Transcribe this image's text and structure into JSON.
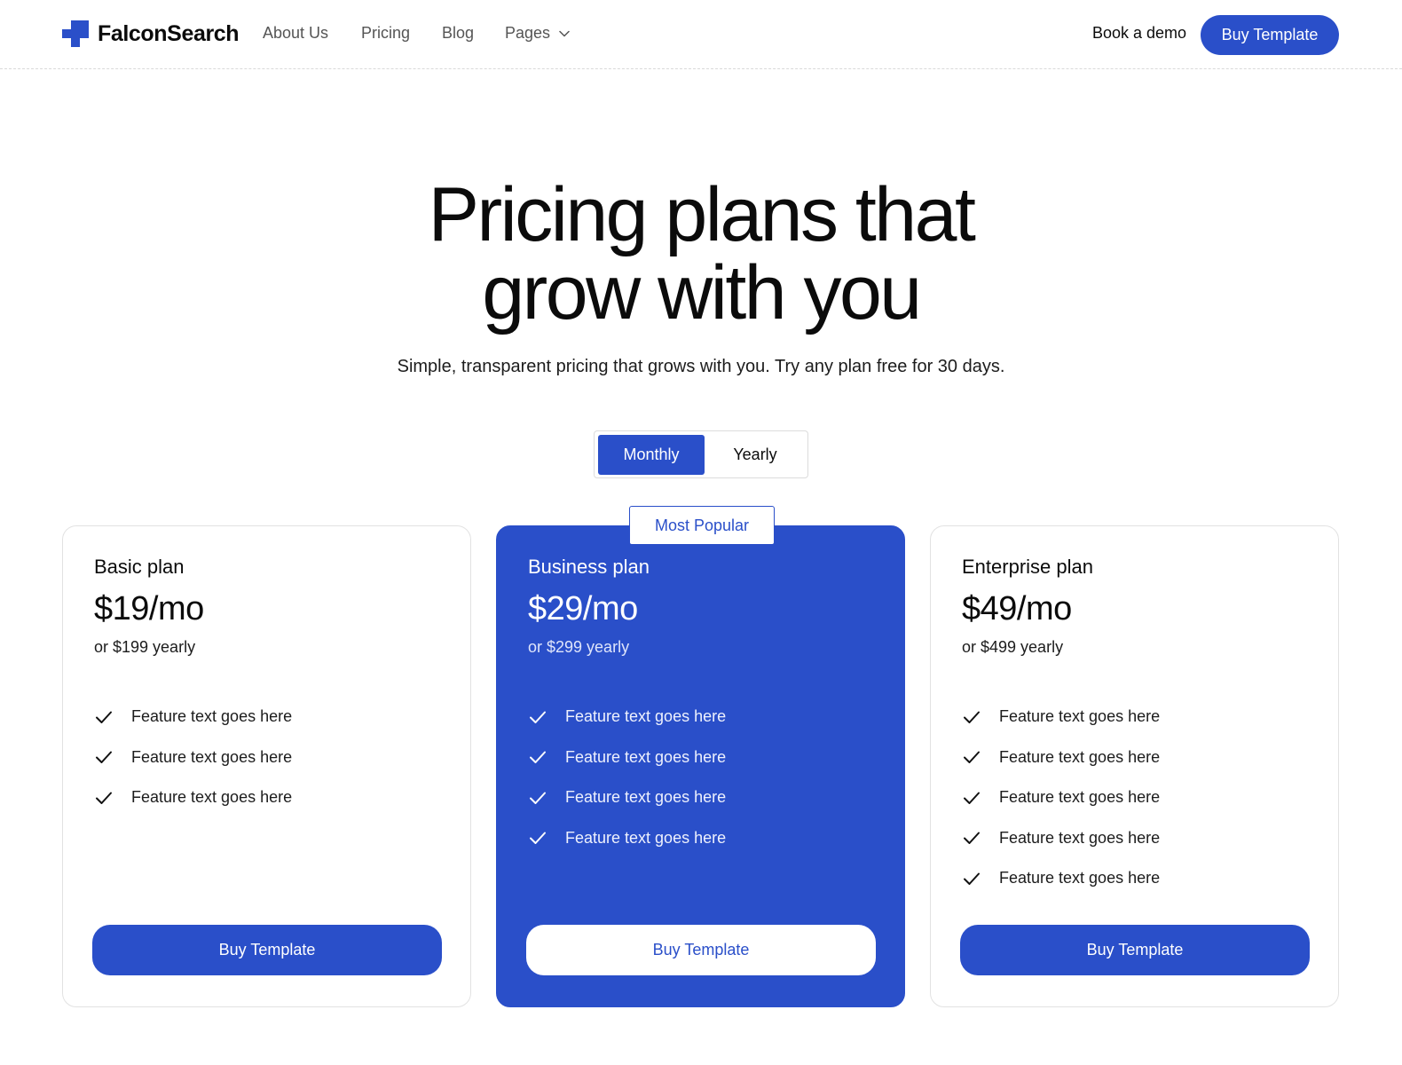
{
  "colors": {
    "accent": "#2a4fc9",
    "text": "#0b0b0b",
    "border": "#e2e2e2"
  },
  "nav": {
    "logo_icon": "plus-cross-logo-icon",
    "logo_text": "FalconSearch",
    "links": [
      "About Us",
      "Pricing",
      "Blog",
      "Pages"
    ],
    "pages_icon": "chevron-down-icon",
    "demo_label": "Book a demo",
    "buy_label": "Buy Template"
  },
  "hero": {
    "title_line1": "Pricing plans that",
    "title_line2": "grow with you",
    "subtitle": "Simple, transparent pricing that grows with you. Try any plan free for 30 days."
  },
  "toggle": {
    "monthly": "Monthly",
    "yearly": "Yearly",
    "selected": "Monthly"
  },
  "plans": [
    {
      "name": "Basic plan",
      "price": "$19/mo",
      "yearly": "or $199 yearly",
      "features": [
        "Feature text goes here",
        "Feature text goes here",
        "Feature text goes here"
      ],
      "button": "Buy Template"
    },
    {
      "badge": "Most Popular",
      "name": "Business plan",
      "price": "$29/mo",
      "yearly": "or $299 yearly",
      "features": [
        "Feature text goes here",
        "Feature text goes here",
        "Feature text goes here",
        "Feature text goes here"
      ],
      "button": "Buy Template"
    },
    {
      "name": "Enterprise plan",
      "price": "$49/mo",
      "yearly": "or $499 yearly",
      "features": [
        "Feature text goes here",
        "Feature text goes here",
        "Feature text goes here",
        "Feature text goes here",
        "Feature text goes here"
      ],
      "button": "Buy Template"
    }
  ],
  "feature_icon": "check-icon"
}
